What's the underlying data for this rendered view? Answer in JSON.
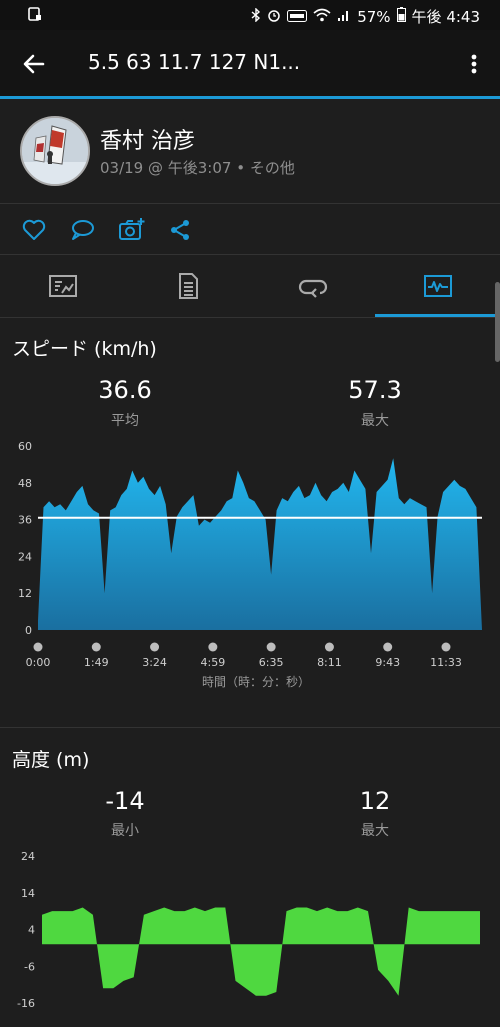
{
  "status_bar": {
    "battery": "57%",
    "time": "午後 4:43"
  },
  "app_bar": {
    "title": "5.5  63  11.7  127  N1..."
  },
  "profile": {
    "name": "香村 治彦",
    "subtitle": "03/19 @ 午後3:07 • その他"
  },
  "speed": {
    "title": "スピード (km/h)",
    "avg_value": "36.6",
    "avg_label": "平均",
    "max_value": "57.3",
    "max_label": "最大"
  },
  "elevation": {
    "title": "高度 (m)",
    "min_value": "-14",
    "min_label": "最小",
    "max_value": "12",
    "max_label": "最大"
  },
  "colors": {
    "accent": "#1c9ad6",
    "speed_fill_top": "#22b7ef",
    "speed_fill_bottom": "#1a6fa0",
    "elevation_fill": "#4fd840",
    "background": "#1e1e1e"
  },
  "chart_data": [
    {
      "type": "area",
      "y_ticks": [
        "60",
        "48",
        "36",
        "24",
        "12",
        "0"
      ],
      "ylim": [
        0,
        60
      ],
      "x_ticks": [
        "0:00",
        "1:49",
        "3:24",
        "4:59",
        "6:35",
        "8:11",
        "9:43",
        "11:33"
      ],
      "xlabel": "時間（時：分：秒）",
      "average_line": 36.6,
      "values": [
        3,
        40,
        42,
        40,
        41,
        39,
        42,
        45,
        47,
        41,
        39,
        38,
        12,
        39,
        40,
        44,
        46,
        52,
        48,
        50,
        46,
        44,
        47,
        41,
        25,
        37,
        40,
        42,
        44,
        34,
        36,
        35,
        37,
        39,
        42,
        43,
        52,
        48,
        43,
        42,
        39,
        36,
        18,
        39,
        43,
        42,
        45,
        47,
        43,
        44,
        48,
        44,
        42,
        45,
        46,
        48,
        45,
        52,
        49,
        46,
        25,
        45,
        47,
        49,
        56,
        43,
        41,
        43,
        42,
        41,
        40,
        12,
        37,
        45,
        47,
        49,
        47,
        46,
        43,
        40,
        0
      ]
    },
    {
      "type": "area",
      "y_ticks": [
        "24",
        "14",
        "4",
        "-6",
        "-16"
      ],
      "ylim": [
        -16,
        24
      ],
      "values": [
        8,
        9,
        9,
        9,
        10,
        8,
        -12,
        -12,
        -10,
        -9,
        8,
        9,
        10,
        9,
        9,
        10,
        9,
        10,
        10,
        -10,
        -12,
        -14,
        -14,
        -13,
        9,
        10,
        10,
        9,
        10,
        9,
        9,
        10,
        9,
        -7,
        -10,
        -14,
        10,
        9,
        9,
        9,
        9,
        9,
        9,
        9
      ]
    }
  ]
}
